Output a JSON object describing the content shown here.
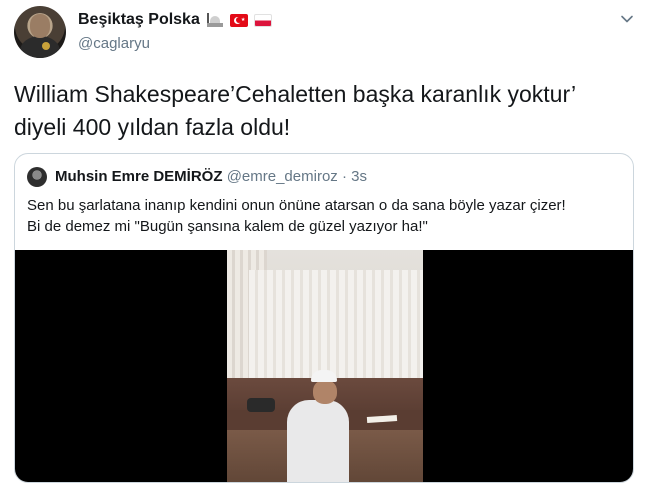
{
  "author": {
    "display_name": "Beşiktaş Polska",
    "handle": "@caglaryu"
  },
  "tweet": {
    "line1": "William Shakespeare’Cehaletten başka karanlık yoktur’",
    "line2": "diyeli 400 yıldan fazla oldu!"
  },
  "quoted": {
    "name": "Muhsin Emre DEMİRÖZ",
    "handle": "@emre_demiroz",
    "dot": "·",
    "time": "3s",
    "line1": "Sen bu şarlatana inanıp kendini onun önüne atarsan o da sana böyle yazar çizer!",
    "line2": "Bi de demez mi \"Bugün şansına kalem de güzel yazıyor ha!\""
  },
  "icons": {
    "caret": "chevron-down-icon",
    "emoji1": "mosque-emoji",
    "emoji2": "turkey-flag-emoji",
    "emoji3": "poland-flag-emoji"
  },
  "colors": {
    "text": "#14171a",
    "secondary": "#657786",
    "border": "#ccd6dd"
  }
}
